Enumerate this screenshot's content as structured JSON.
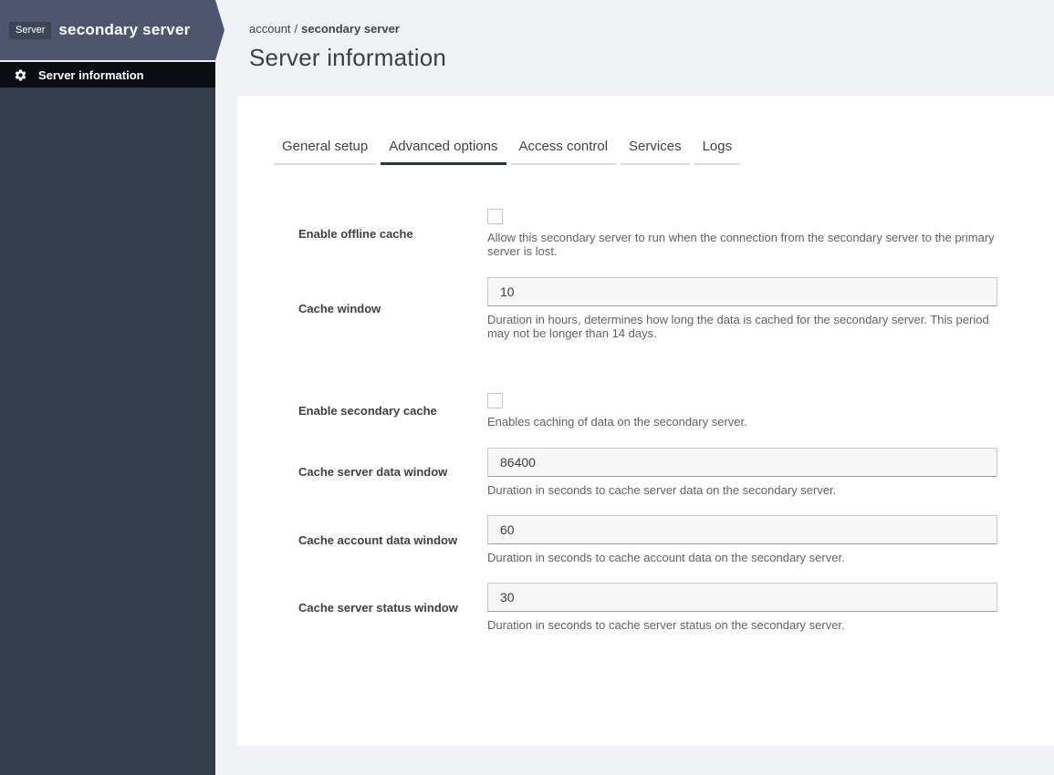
{
  "sidebar": {
    "badge": "Server",
    "title": "secondary server",
    "nav": {
      "label": "Server information",
      "icon": "gear-icon"
    }
  },
  "breadcrumb": {
    "parent": "account",
    "separator": "/",
    "current": "secondary server"
  },
  "page": {
    "title": "Server information"
  },
  "tabs": [
    {
      "label": "General setup",
      "active": false
    },
    {
      "label": "Advanced options",
      "active": true
    },
    {
      "label": "Access control",
      "active": false
    },
    {
      "label": "Services",
      "active": false
    },
    {
      "label": "Logs",
      "active": false
    }
  ],
  "form": {
    "fields": [
      {
        "type": "checkbox",
        "label": "Enable offline cache",
        "checked": false,
        "help": "Allow this secondary server to run when the connection from the secondary server to the primary server is lost."
      },
      {
        "type": "text",
        "label": "Cache window",
        "value": "10",
        "help": "Duration in hours, determines how long the data is cached for the secondary server. This period may not be longer than 14 days."
      },
      {
        "type": "checkbox",
        "label": "Enable secondary cache",
        "checked": false,
        "help": "Enables caching of data on the secondary server."
      },
      {
        "type": "text",
        "label": "Cache server data window",
        "value": "86400",
        "help": "Duration in seconds to cache server data on the secondary server."
      },
      {
        "type": "text",
        "label": "Cache account data window",
        "value": "60",
        "help": "Duration in seconds to cache account data on the secondary server."
      },
      {
        "type": "text",
        "label": "Cache server status window",
        "value": "30",
        "help": "Duration in seconds to cache server status on the secondary server."
      }
    ]
  },
  "colors": {
    "sidebar_header": "#4d566e",
    "sidebar_body": "#343b4d",
    "sidebar_nav_bg": "#0a0c12",
    "badge_bg": "#3d4456",
    "page_bg": "#f1f2f5",
    "panel_bg": "#ffffff",
    "active_tab_underline": "#2b3245",
    "inactive_tab_underline": "#dcdcdc",
    "input_bg": "#f7f7f8",
    "help_text": "#5f6368"
  }
}
